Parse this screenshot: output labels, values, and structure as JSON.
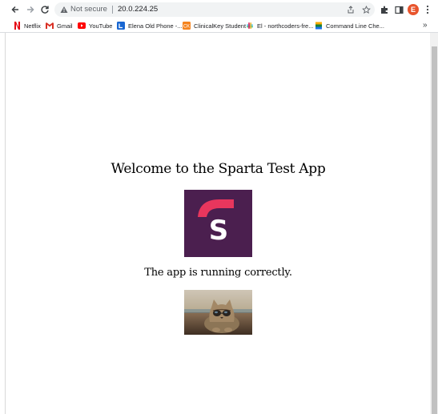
{
  "browser": {
    "omnibox": {
      "security_label": "Not secure",
      "url": "20.0.224.25"
    },
    "profile_initial": "E",
    "profile_color": "#e8542c",
    "bookmarks": [
      {
        "label": "Netflix",
        "icon": "netflix-icon"
      },
      {
        "label": "Gmail",
        "icon": "gmail-icon"
      },
      {
        "label": "YouTube",
        "icon": "youtube-icon"
      },
      {
        "label": "Elena Old Phone -...",
        "icon": "phone-icon"
      },
      {
        "label": "ClinicalKey Student",
        "icon": "clinicalkey-icon"
      },
      {
        "label": "El - northcoders-fre...",
        "icon": "slack-icon"
      },
      {
        "label": "Command Line Che...",
        "icon": "command-line-icon"
      }
    ],
    "bookmarks_overflow": "»"
  },
  "page": {
    "title": "Welcome to the Sparta Test App",
    "status": "The app is running correctly.",
    "logo_letter": "S",
    "logo_colors": {
      "background": "#4b1f4f",
      "accent": "#e8365d",
      "letter": "#ffffff"
    }
  }
}
